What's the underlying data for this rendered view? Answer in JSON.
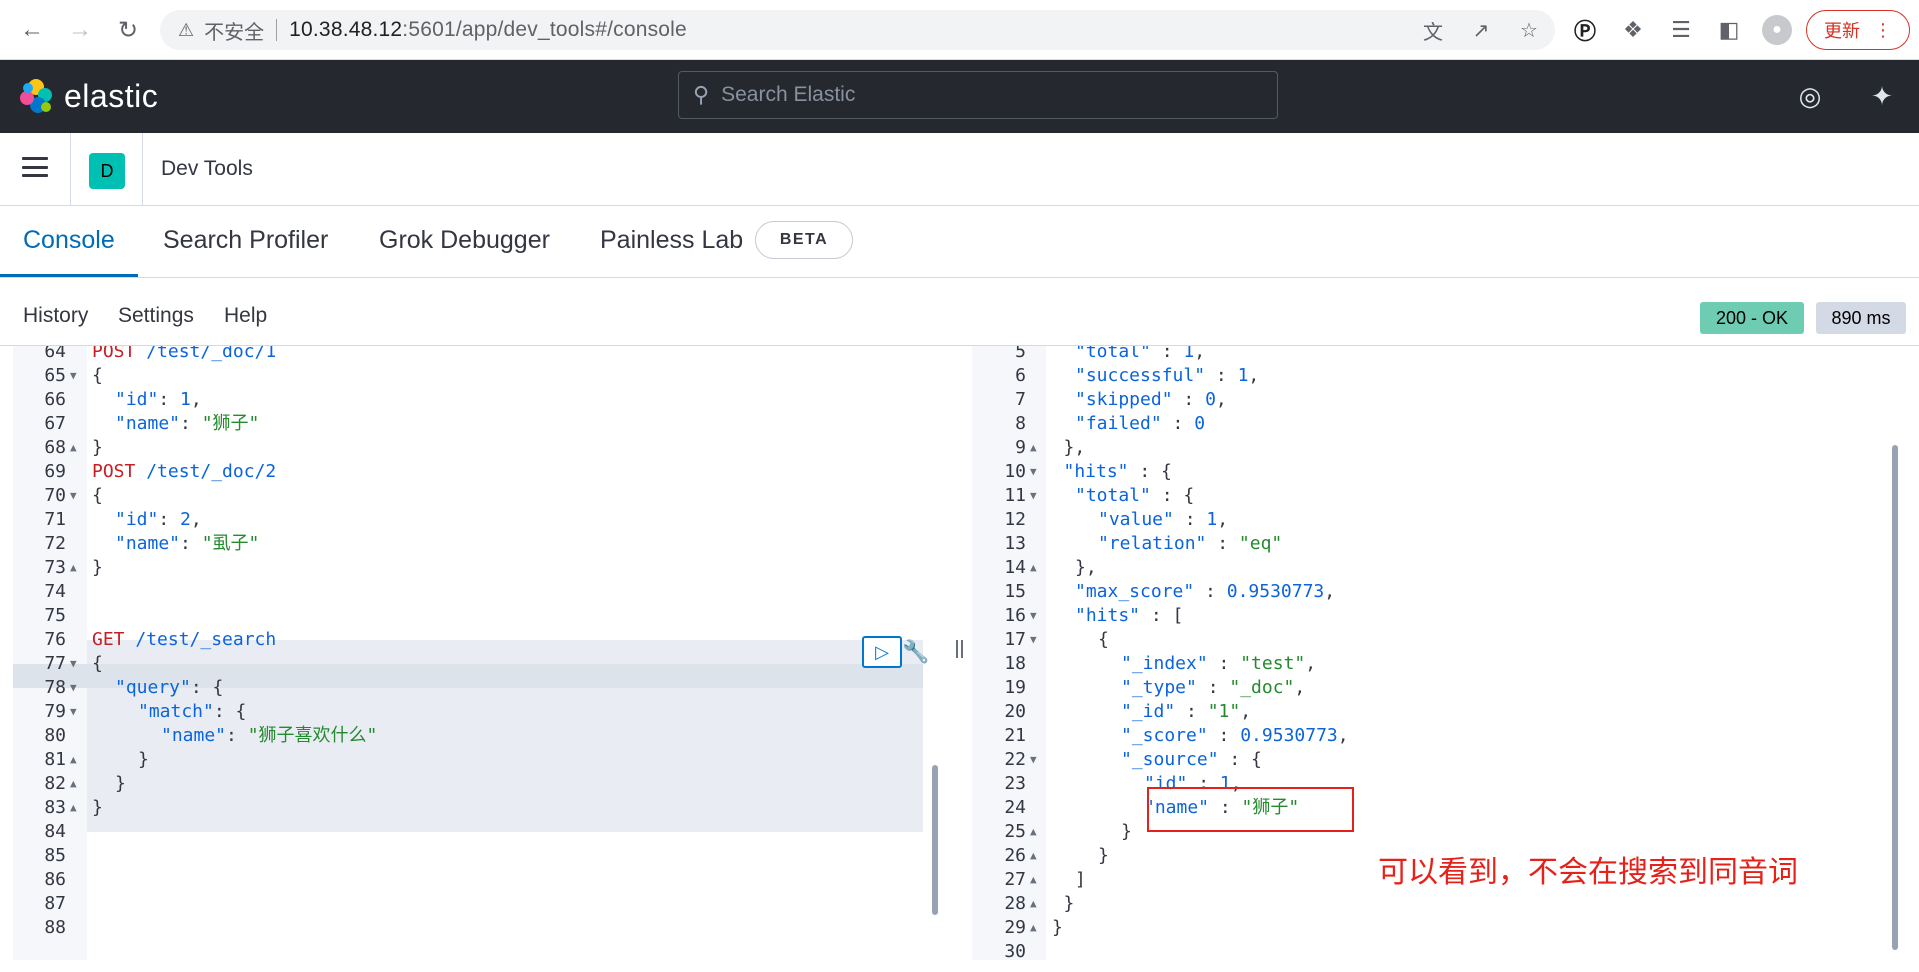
{
  "browser": {
    "insecure_label": "不安全",
    "url_host": "10.38.48.12",
    "url_rest": ":5601/app/dev_tools#/console",
    "update_label": "更新"
  },
  "header": {
    "brand": "elastic",
    "search_placeholder": "Search Elastic"
  },
  "breadcrumb": {
    "space_initial": "D",
    "title": "Dev Tools"
  },
  "tabs": [
    {
      "label": "Console"
    },
    {
      "label": "Search Profiler"
    },
    {
      "label": "Grok Debugger"
    },
    {
      "label": "Painless Lab"
    }
  ],
  "beta_badge": "BETA",
  "toolbar": {
    "history": "History",
    "settings": "Settings",
    "help": "Help",
    "status": "200 - OK",
    "duration": "890 ms"
  },
  "request_lines": [
    {
      "n": "64",
      "fold": "",
      "ind": 0,
      "t": [
        [
          "method",
          "POST"
        ],
        [
          "path",
          " /test/_doc/1"
        ]
      ]
    },
    {
      "n": "65",
      "fold": "▼",
      "ind": 0,
      "t": [
        [
          "plain",
          "{"
        ]
      ]
    },
    {
      "n": "66",
      "fold": "",
      "ind": 1,
      "t": [
        [
          "key",
          "\"id\""
        ],
        [
          "plain",
          ": "
        ],
        [
          "num",
          "1"
        ],
        [
          "plain",
          ","
        ]
      ]
    },
    {
      "n": "67",
      "fold": "",
      "ind": 1,
      "t": [
        [
          "key",
          "\"name\""
        ],
        [
          "plain",
          ": "
        ],
        [
          "str",
          "\"狮子\""
        ]
      ]
    },
    {
      "n": "68",
      "fold": "▲",
      "ind": 0,
      "t": [
        [
          "plain",
          "}"
        ]
      ]
    },
    {
      "n": "69",
      "fold": "",
      "ind": 0,
      "t": [
        [
          "method",
          "POST"
        ],
        [
          "path",
          " /test/_doc/2"
        ]
      ]
    },
    {
      "n": "70",
      "fold": "▼",
      "ind": 0,
      "t": [
        [
          "plain",
          "{"
        ]
      ]
    },
    {
      "n": "71",
      "fold": "",
      "ind": 1,
      "t": [
        [
          "key",
          "\"id\""
        ],
        [
          "plain",
          ": "
        ],
        [
          "num",
          "2"
        ],
        [
          "plain",
          ","
        ]
      ]
    },
    {
      "n": "72",
      "fold": "",
      "ind": 1,
      "t": [
        [
          "key",
          "\"name\""
        ],
        [
          "plain",
          ": "
        ],
        [
          "str",
          "\"虱子\""
        ]
      ]
    },
    {
      "n": "73",
      "fold": "▲",
      "ind": 0,
      "t": [
        [
          "plain",
          "}"
        ]
      ]
    },
    {
      "n": "74",
      "fold": "",
      "ind": 0,
      "t": []
    },
    {
      "n": "75",
      "fold": "",
      "ind": 0,
      "t": []
    },
    {
      "n": "76",
      "fold": "",
      "ind": 0,
      "t": [
        [
          "method",
          "GET"
        ],
        [
          "path",
          " /test/_search"
        ]
      ]
    },
    {
      "n": "77",
      "fold": "▼",
      "ind": 0,
      "t": [
        [
          "plain",
          "{"
        ]
      ]
    },
    {
      "n": "78",
      "fold": "▼",
      "ind": 1,
      "t": [
        [
          "key",
          "\"query\""
        ],
        [
          "plain",
          ": {"
        ]
      ]
    },
    {
      "n": "79",
      "fold": "▼",
      "ind": 2,
      "t": [
        [
          "key",
          "\"match\""
        ],
        [
          "plain",
          ": {"
        ]
      ]
    },
    {
      "n": "80",
      "fold": "",
      "ind": 3,
      "t": [
        [
          "key",
          "\"name\""
        ],
        [
          "plain",
          ": "
        ],
        [
          "str",
          "\"狮子喜欢什么\""
        ]
      ]
    },
    {
      "n": "81",
      "fold": "▲",
      "ind": 2,
      "t": [
        [
          "plain",
          "}"
        ]
      ]
    },
    {
      "n": "82",
      "fold": "▲",
      "ind": 1,
      "t": [
        [
          "plain",
          "}"
        ]
      ]
    },
    {
      "n": "83",
      "fold": "▲",
      "ind": 0,
      "t": [
        [
          "plain",
          "}"
        ]
      ]
    },
    {
      "n": "84",
      "fold": "",
      "ind": 0,
      "t": []
    },
    {
      "n": "85",
      "fold": "",
      "ind": 0,
      "t": []
    },
    {
      "n": "86",
      "fold": "",
      "ind": 0,
      "t": []
    },
    {
      "n": "87",
      "fold": "",
      "ind": 0,
      "t": []
    },
    {
      "n": "88",
      "fold": "",
      "ind": 0,
      "t": []
    }
  ],
  "response_lines": [
    {
      "n": "5",
      "fold": "",
      "ind": 1,
      "t": [
        [
          "key",
          "\"total\""
        ],
        [
          "plain",
          " : "
        ],
        [
          "num",
          "1"
        ],
        [
          "plain",
          ","
        ]
      ]
    },
    {
      "n": "6",
      "fold": "",
      "ind": 1,
      "t": [
        [
          "key",
          "\"successful\""
        ],
        [
          "plain",
          " : "
        ],
        [
          "num",
          "1"
        ],
        [
          "plain",
          ","
        ]
      ]
    },
    {
      "n": "7",
      "fold": "",
      "ind": 1,
      "t": [
        [
          "key",
          "\"skipped\""
        ],
        [
          "plain",
          " : "
        ],
        [
          "num",
          "0"
        ],
        [
          "plain",
          ","
        ]
      ]
    },
    {
      "n": "8",
      "fold": "",
      "ind": 1,
      "t": [
        [
          "key",
          "\"failed\""
        ],
        [
          "plain",
          " : "
        ],
        [
          "num",
          "0"
        ]
      ]
    },
    {
      "n": "9",
      "fold": "▲",
      "ind": 0.5,
      "t": [
        [
          "plain",
          "},"
        ]
      ]
    },
    {
      "n": "10",
      "fold": "▼",
      "ind": 0.5,
      "t": [
        [
          "key",
          "\"hits\""
        ],
        [
          "plain",
          " : {"
        ]
      ]
    },
    {
      "n": "11",
      "fold": "▼",
      "ind": 1,
      "t": [
        [
          "key",
          "\"total\""
        ],
        [
          "plain",
          " : {"
        ]
      ]
    },
    {
      "n": "12",
      "fold": "",
      "ind": 2,
      "t": [
        [
          "key",
          "\"value\""
        ],
        [
          "plain",
          " : "
        ],
        [
          "num",
          "1"
        ],
        [
          "plain",
          ","
        ]
      ]
    },
    {
      "n": "13",
      "fold": "",
      "ind": 2,
      "t": [
        [
          "key",
          "\"relation\""
        ],
        [
          "plain",
          " : "
        ],
        [
          "str",
          "\"eq\""
        ]
      ]
    },
    {
      "n": "14",
      "fold": "▲",
      "ind": 1,
      "t": [
        [
          "plain",
          "},"
        ]
      ]
    },
    {
      "n": "15",
      "fold": "",
      "ind": 1,
      "t": [
        [
          "key",
          "\"max_score\""
        ],
        [
          "plain",
          " : "
        ],
        [
          "num",
          "0.9530773"
        ],
        [
          "plain",
          ","
        ]
      ]
    },
    {
      "n": "16",
      "fold": "▼",
      "ind": 1,
      "t": [
        [
          "key",
          "\"hits\""
        ],
        [
          "plain",
          " : ["
        ]
      ]
    },
    {
      "n": "17",
      "fold": "▼",
      "ind": 2,
      "t": [
        [
          "plain",
          "{"
        ]
      ]
    },
    {
      "n": "18",
      "fold": "",
      "ind": 3,
      "t": [
        [
          "key",
          "\"_index\""
        ],
        [
          "plain",
          " : "
        ],
        [
          "str",
          "\"test\""
        ],
        [
          "plain",
          ","
        ]
      ]
    },
    {
      "n": "19",
      "fold": "",
      "ind": 3,
      "t": [
        [
          "key",
          "\"_type\""
        ],
        [
          "plain",
          " : "
        ],
        [
          "str",
          "\"_doc\""
        ],
        [
          "plain",
          ","
        ]
      ]
    },
    {
      "n": "20",
      "fold": "",
      "ind": 3,
      "t": [
        [
          "key",
          "\"_id\""
        ],
        [
          "plain",
          " : "
        ],
        [
          "str",
          "\"1\""
        ],
        [
          "plain",
          ","
        ]
      ]
    },
    {
      "n": "21",
      "fold": "",
      "ind": 3,
      "t": [
        [
          "key",
          "\"_score\""
        ],
        [
          "plain",
          " : "
        ],
        [
          "num",
          "0.9530773"
        ],
        [
          "plain",
          ","
        ]
      ]
    },
    {
      "n": "22",
      "fold": "▼",
      "ind": 3,
      "t": [
        [
          "key",
          "\"_source\""
        ],
        [
          "plain",
          " : {"
        ]
      ]
    },
    {
      "n": "23",
      "fold": "",
      "ind": 4,
      "t": [
        [
          "key",
          "\"id\""
        ],
        [
          "plain",
          " : "
        ],
        [
          "num",
          "1"
        ],
        [
          "plain",
          ","
        ]
      ]
    },
    {
      "n": "24",
      "fold": "",
      "ind": 4,
      "t": [
        [
          "key",
          "\"name\""
        ],
        [
          "plain",
          " : "
        ],
        [
          "str",
          "\"狮子\""
        ]
      ]
    },
    {
      "n": "25",
      "fold": "▲",
      "ind": 3,
      "t": [
        [
          "plain",
          "}"
        ]
      ]
    },
    {
      "n": "26",
      "fold": "▲",
      "ind": 2,
      "t": [
        [
          "plain",
          "}"
        ]
      ]
    },
    {
      "n": "27",
      "fold": "▲",
      "ind": 1,
      "t": [
        [
          "plain",
          "]"
        ]
      ]
    },
    {
      "n": "28",
      "fold": "▲",
      "ind": 0.5,
      "t": [
        [
          "plain",
          "}"
        ]
      ]
    },
    {
      "n": "29",
      "fold": "▲",
      "ind": 0,
      "t": [
        [
          "plain",
          "}"
        ]
      ]
    },
    {
      "n": "30",
      "fold": "",
      "ind": 0,
      "t": []
    }
  ],
  "annotation": "可以看到，不会在搜索到同音词",
  "colors": {
    "header_bg": "#25282f",
    "active_tab": "#006bb8",
    "status_ok": "#6dccb1",
    "annotation": "#e5211a"
  }
}
